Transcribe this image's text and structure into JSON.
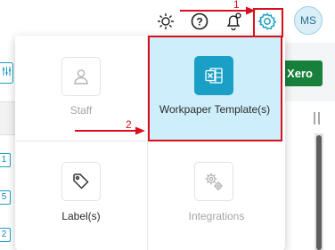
{
  "header": {
    "avatar_initials": "MS",
    "icons": [
      "sun-icon",
      "help-icon",
      "bell-icon",
      "gear-icon"
    ]
  },
  "annotations": {
    "step1": "1",
    "step2": "2",
    "highlight_color": "#d80f1f"
  },
  "background": {
    "xero_button": "Xero",
    "row_tags": [
      "1",
      "5",
      "2"
    ]
  },
  "settings_menu": {
    "tiles": [
      {
        "label": "Staff",
        "icon": "user-icon",
        "enabled": false
      },
      {
        "label": "Workpaper Template(s)",
        "icon": "excel-icon",
        "enabled": true,
        "highlighted": true
      },
      {
        "label": "Label(s)",
        "icon": "tag-icon",
        "enabled": true
      },
      {
        "label": "Integrations",
        "icon": "gears-icon",
        "enabled": false
      }
    ]
  },
  "colors": {
    "accent": "#1aa0c6",
    "highlight_bg": "#cdeefa",
    "xero_green": "#17813c"
  }
}
